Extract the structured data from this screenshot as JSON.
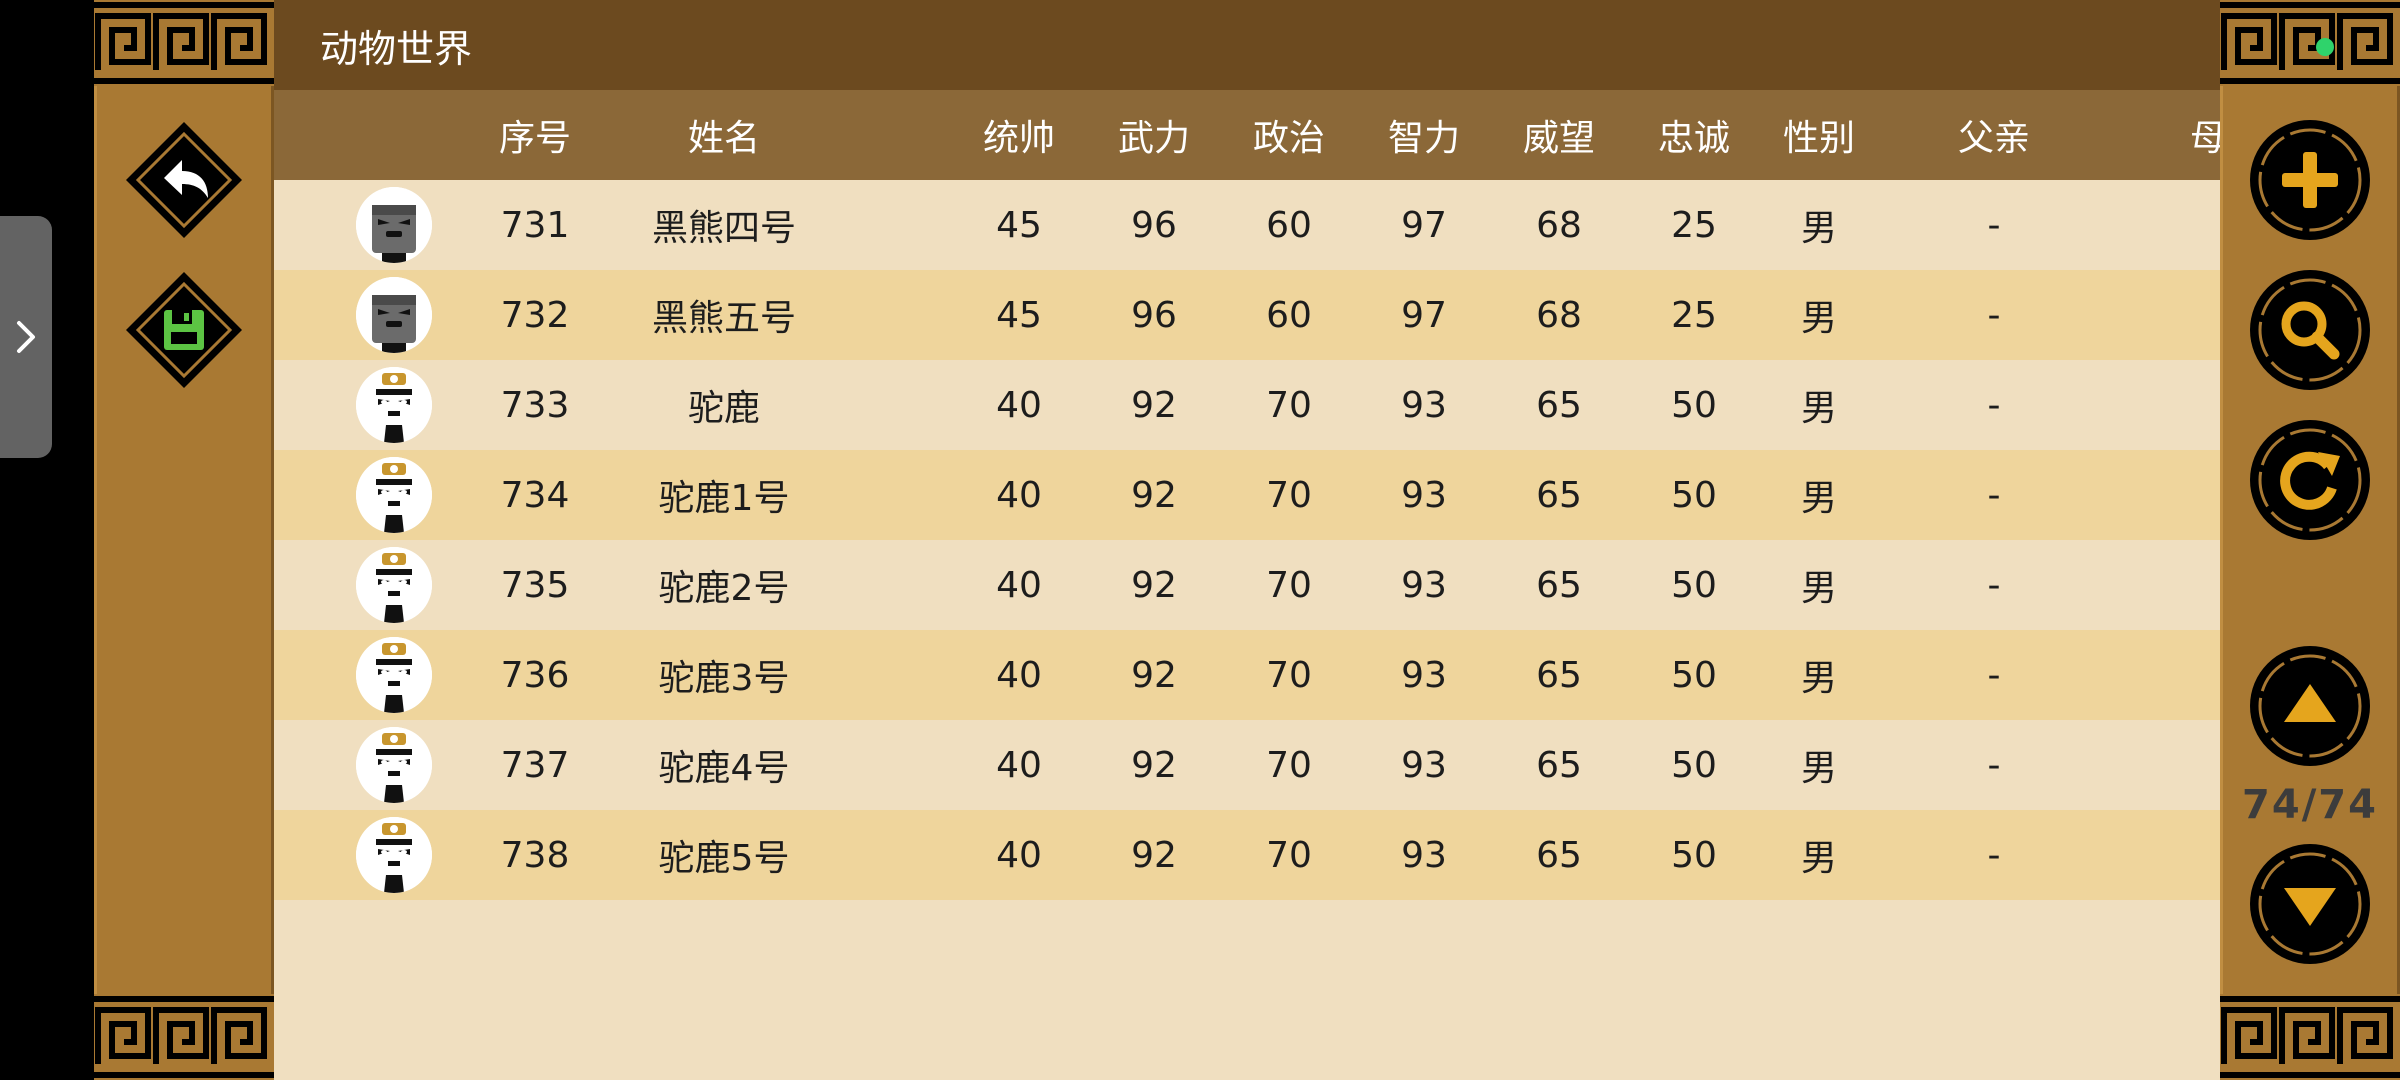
{
  "window": {
    "title": "动物世界"
  },
  "table": {
    "headers": {
      "id": "序号",
      "name": "姓名",
      "command": "统帅",
      "force": "武力",
      "politics": "政治",
      "intellect": "智力",
      "prestige": "威望",
      "loyalty": "忠诚",
      "gender": "性别",
      "father": "父亲",
      "mother": "母亲"
    },
    "rows": [
      {
        "avatar": "bear-avatar-icon",
        "id": "731",
        "name": "黑熊四号",
        "command": "45",
        "force": "96",
        "politics": "60",
        "intellect": "97",
        "prestige": "68",
        "loyalty": "25",
        "gender": "男",
        "father": "-",
        "mother": "-"
      },
      {
        "avatar": "bear-avatar-icon",
        "id": "732",
        "name": "黑熊五号",
        "command": "45",
        "force": "96",
        "politics": "60",
        "intellect": "97",
        "prestige": "68",
        "loyalty": "25",
        "gender": "男",
        "father": "-",
        "mother": "-"
      },
      {
        "avatar": "ostrich-avatar-icon",
        "id": "733",
        "name": "驼鹿",
        "command": "40",
        "force": "92",
        "politics": "70",
        "intellect": "93",
        "prestige": "65",
        "loyalty": "50",
        "gender": "男",
        "father": "-",
        "mother": "-"
      },
      {
        "avatar": "ostrich-avatar-icon",
        "id": "734",
        "name": "驼鹿1号",
        "command": "40",
        "force": "92",
        "politics": "70",
        "intellect": "93",
        "prestige": "65",
        "loyalty": "50",
        "gender": "男",
        "father": "-",
        "mother": "-"
      },
      {
        "avatar": "ostrich-avatar-icon",
        "id": "735",
        "name": "驼鹿2号",
        "command": "40",
        "force": "92",
        "politics": "70",
        "intellect": "93",
        "prestige": "65",
        "loyalty": "50",
        "gender": "男",
        "father": "-",
        "mother": "-"
      },
      {
        "avatar": "ostrich-avatar-icon",
        "id": "736",
        "name": "驼鹿3号",
        "command": "40",
        "force": "92",
        "politics": "70",
        "intellect": "93",
        "prestige": "65",
        "loyalty": "50",
        "gender": "男",
        "father": "-",
        "mother": "-"
      },
      {
        "avatar": "ostrich-avatar-icon",
        "id": "737",
        "name": "驼鹿4号",
        "command": "40",
        "force": "92",
        "politics": "70",
        "intellect": "93",
        "prestige": "65",
        "loyalty": "50",
        "gender": "男",
        "father": "-",
        "mother": "-"
      },
      {
        "avatar": "ostrich-avatar-icon",
        "id": "738",
        "name": "驼鹿5号",
        "command": "40",
        "force": "92",
        "politics": "70",
        "intellect": "93",
        "prestige": "65",
        "loyalty": "50",
        "gender": "男",
        "father": "-",
        "mother": "-"
      }
    ]
  },
  "pagination": {
    "current": 74,
    "total": 74,
    "label": "74/74"
  },
  "left_buttons": [
    "back-arrow-icon",
    "save-disk-icon"
  ],
  "right_buttons": [
    "plus-icon",
    "search-icon",
    "refresh-icon",
    "triangle-up-icon",
    "triangle-down-icon"
  ],
  "colors": {
    "title_bar": "#6c4a1f",
    "header_row": "#8b6838",
    "row_light": "#f0dfc0",
    "row_alt": "#efd59c",
    "side_panel": "#a97933",
    "save_icon": "#5cc443",
    "status_dot": "#2fd36b"
  }
}
